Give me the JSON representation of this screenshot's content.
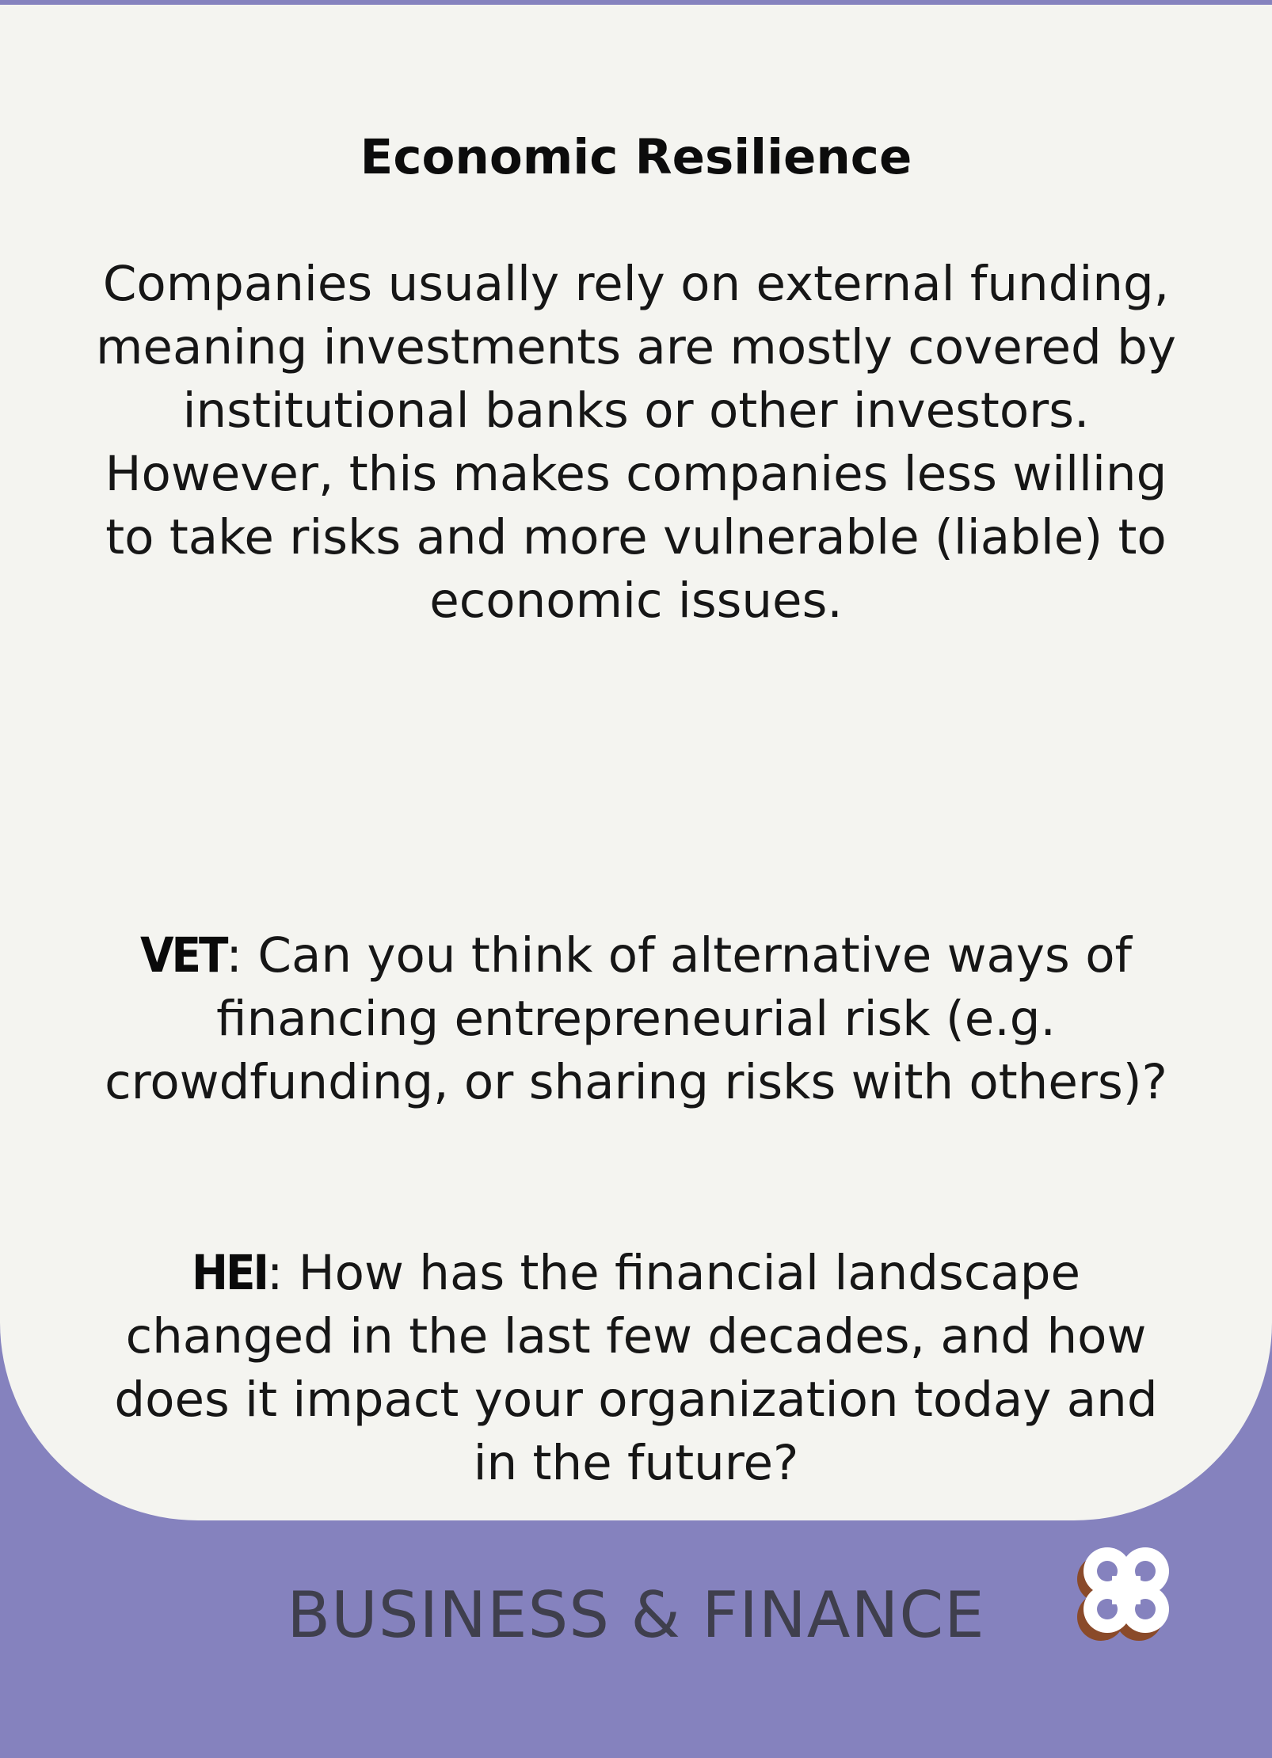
{
  "card": {
    "title": "Economic Resilience",
    "intro": "Companies usually rely on external funding, meaning investments are mostly covered by institutional banks or other investors. However, this makes companies less willing to take risks and more vulnerable (liable) to economic issues.",
    "questions": [
      {
        "tag": "VET",
        "separator": ":",
        "text": " Can you think of alternative ways of financing entrepreneurial risk (e.g. crowdfunding, or sharing risks with others)?"
      },
      {
        "tag": "HEI",
        "separator": ":",
        "text": " How has the financial landscape changed in the last few decades, and how does it impact your organization today and in the future?"
      }
    ]
  },
  "footer": {
    "category": "BUSINESS & FINANCE",
    "logo_icon": "quatrefoil-logo-icon"
  },
  "colors": {
    "background": "#8582be",
    "card": "#f4f4f0",
    "category_text": "#3f3f4d",
    "logo_fill": "#ffffff",
    "logo_shadow": "#8a4a2a"
  }
}
